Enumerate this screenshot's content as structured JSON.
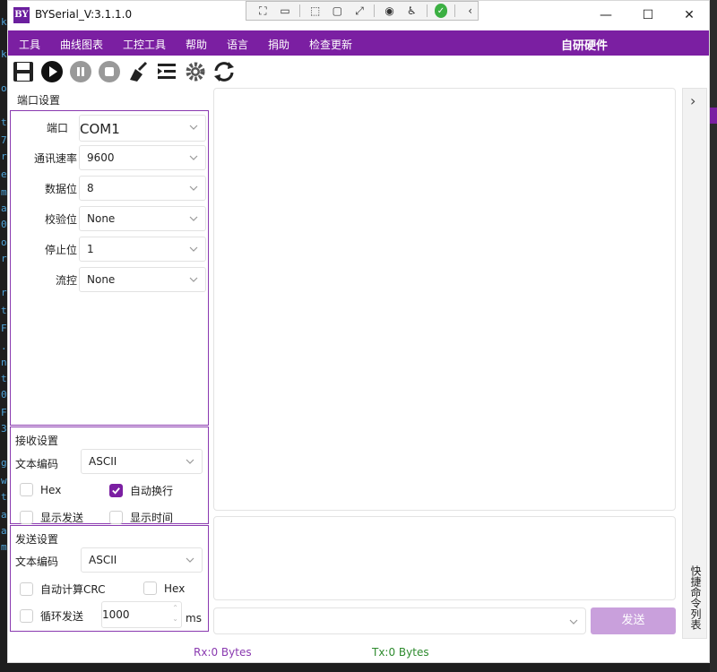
{
  "app": {
    "title": "BYSerial_V:3.1.1.0",
    "logo_text": "BY"
  },
  "window_controls": {
    "minimize": "—",
    "maximize": "☐",
    "close": "✕"
  },
  "menu": {
    "items": [
      "工具",
      "曲线图表",
      "工控工具",
      "帮助",
      "语言",
      "捐助",
      "检查更新"
    ],
    "brand": "自研硬件"
  },
  "toolbar": {
    "icons": [
      "save-icon",
      "play-icon",
      "pause-icon",
      "stop-icon",
      "clear-broom-icon",
      "list-indent-icon",
      "gear-icon",
      "refresh-icon"
    ]
  },
  "port_settings": {
    "title": "端口设置",
    "rows": [
      {
        "label": "端口",
        "value": "COM1"
      },
      {
        "label": "通讯速率",
        "value": "9600"
      },
      {
        "label": "数据位",
        "value": "8"
      },
      {
        "label": "校验位",
        "value": "None"
      },
      {
        "label": "停止位",
        "value": "1"
      },
      {
        "label": "流控",
        "value": "None"
      }
    ]
  },
  "receive_settings": {
    "title": "接收设置",
    "encoding_label": "文本编码",
    "encoding_value": "ASCII",
    "checks": [
      {
        "label": "Hex",
        "checked": false
      },
      {
        "label": "自动换行",
        "checked": true
      },
      {
        "label": "显示发送",
        "checked": false
      },
      {
        "label": "显示时间",
        "checked": false
      }
    ]
  },
  "send_settings": {
    "title": "发送设置",
    "encoding_label": "文本编码",
    "encoding_value": "ASCII",
    "crc_label": "自动计算CRC",
    "hex_label": "Hex",
    "loop_label": "循环发送",
    "interval_value": "1000",
    "interval_unit": "ms"
  },
  "side_panel": {
    "label": "快捷命令列表",
    "chevron": "›"
  },
  "send_button": "发送",
  "status": {
    "rx": "Rx:0 Bytes",
    "tx": "Tx:0 Bytes"
  },
  "colors": {
    "accent": "#7b1fa2",
    "rx": "#8a3ab0",
    "tx": "#2e8b2e"
  }
}
